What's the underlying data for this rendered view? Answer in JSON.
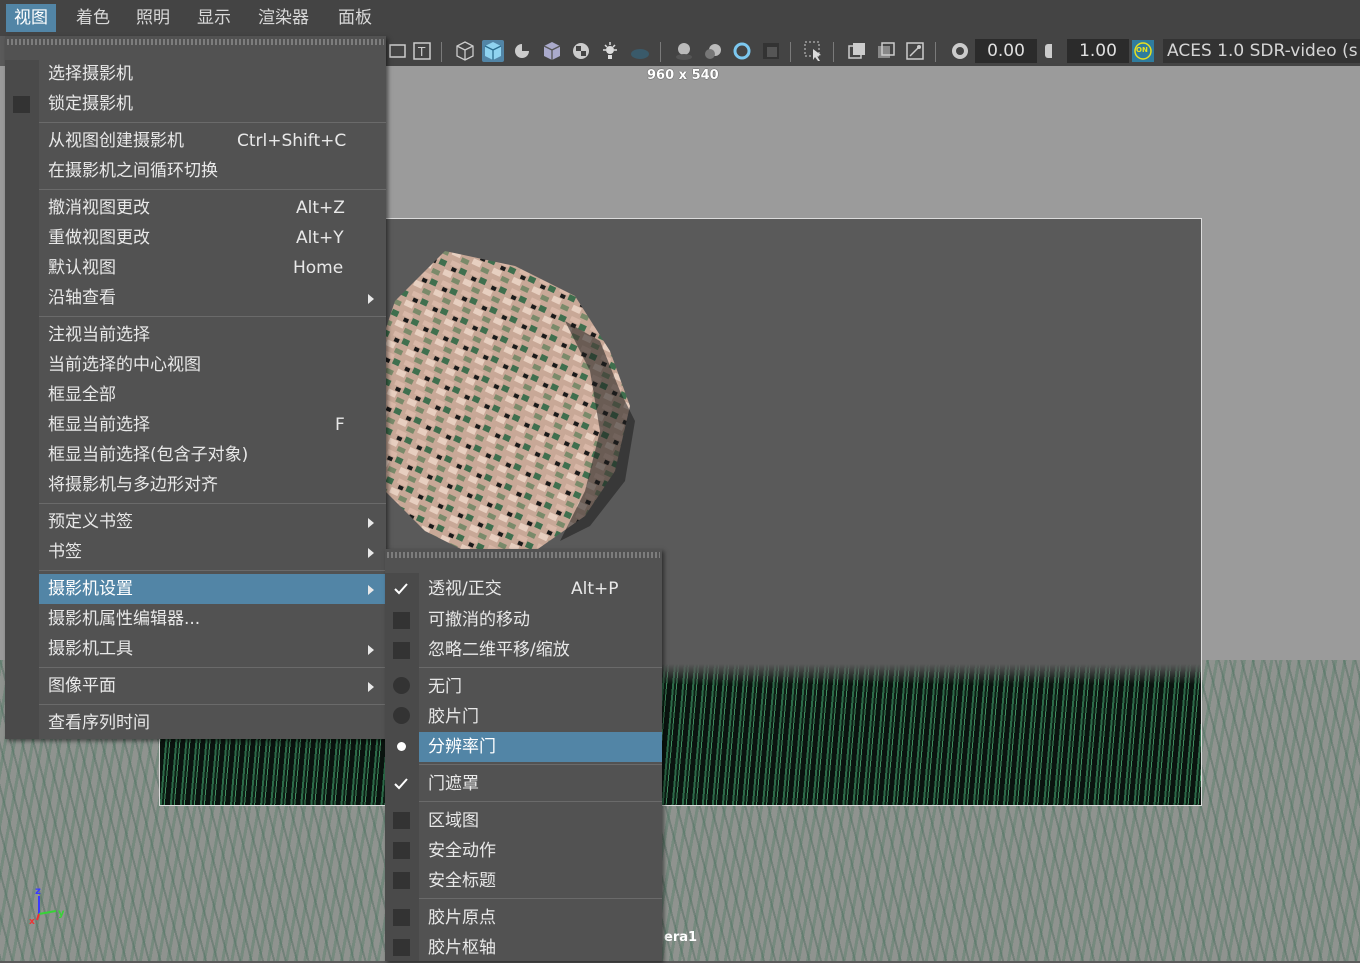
{
  "menubar": {
    "items": [
      "视图",
      "着色",
      "照明",
      "显示",
      "渲染器",
      "面板"
    ],
    "active_index": 0
  },
  "toolbar": {
    "exposure_value": "0.00",
    "gamma_value": "1.00",
    "color_management_badge": "ON",
    "color_space": "ACES 1.0 SDR-video (s"
  },
  "viewport": {
    "resolution_gate_label": "960 x 540",
    "camera_label_partial": "era1",
    "axis_labels": {
      "z": "z",
      "x": "x",
      "y": "y"
    }
  },
  "view_menu": {
    "items": [
      {
        "label": "选择摄影机"
      },
      {
        "label": "锁定摄影机",
        "checkbox": false
      },
      {
        "label": "从视图创建摄影机",
        "shortcut": "Ctrl+Shift+C"
      },
      {
        "label": "在摄影机之间循环切换"
      },
      {
        "label": "撤消视图更改",
        "shortcut": "Alt+Z"
      },
      {
        "label": "重做视图更改",
        "shortcut": "Alt+Y"
      },
      {
        "label": "默认视图",
        "shortcut": "Home"
      },
      {
        "label": "沿轴查看",
        "submenu": true
      },
      {
        "label": "注视当前选择"
      },
      {
        "label": "当前选择的中心视图"
      },
      {
        "label": "框显全部"
      },
      {
        "label": "框显当前选择",
        "shortcut": "F"
      },
      {
        "label": "框显当前选择(包含子对象)"
      },
      {
        "label": "将摄影机与多边形对齐"
      },
      {
        "label": "预定义书签",
        "submenu": true
      },
      {
        "label": "书签",
        "submenu": true
      },
      {
        "label": "摄影机设置",
        "submenu": true,
        "highlighted": true
      },
      {
        "label": "摄影机属性编辑器..."
      },
      {
        "label": "摄影机工具",
        "submenu": true
      },
      {
        "label": "图像平面",
        "submenu": true
      },
      {
        "label": "查看序列时间"
      }
    ]
  },
  "camera_settings_menu": {
    "items": [
      {
        "label": "透视/正交",
        "shortcut": "Alt+P",
        "checked": true
      },
      {
        "label": "可撤消的移动",
        "checked": false
      },
      {
        "label": "忽略二维平移/缩放",
        "checked": false
      },
      {
        "label": "无门",
        "radio_selected": false
      },
      {
        "label": "胶片门",
        "radio_selected": false
      },
      {
        "label": "分辨率门",
        "radio_selected": true,
        "highlighted": true
      },
      {
        "label": "门遮罩",
        "checked": true
      },
      {
        "label": "区域图",
        "checked": false
      },
      {
        "label": "安全动作",
        "checked": false
      },
      {
        "label": "安全标题",
        "checked": false
      },
      {
        "label": "胶片原点",
        "checked": false
      },
      {
        "label": "胶片枢轴",
        "checked": false
      }
    ]
  },
  "colors": {
    "accent": "#5285a6",
    "menu_bg": "#525252",
    "menubar_bg": "#444444",
    "viewport_bg": "#9b9b9b",
    "gate_bg": "#5a5a5a"
  }
}
